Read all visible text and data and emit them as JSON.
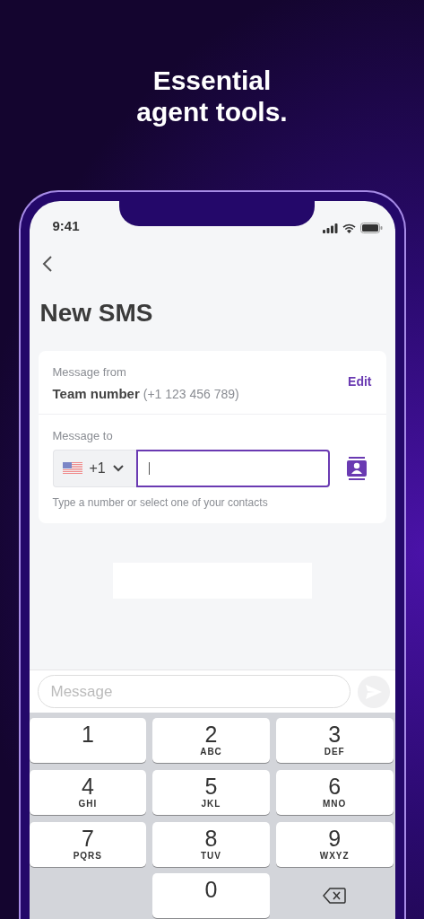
{
  "headline": [
    "Essential",
    "agent tools."
  ],
  "status_bar": {
    "time": "9:41"
  },
  "title": "New SMS",
  "message_from": {
    "label": "Message from",
    "name": "Team number",
    "number": "(+1 123 456 789)",
    "action": "Edit"
  },
  "message_to": {
    "label": "Message to",
    "country_code": "+1",
    "focused": true,
    "hint": "Type a number or select one of your contacts"
  },
  "composer": {
    "placeholder": "Message",
    "send_disabled": true
  },
  "keypad": [
    {
      "kind": "digit",
      "digit": "1"
    },
    {
      "kind": "digit",
      "digit": "2",
      "letters": "ABC"
    },
    {
      "kind": "digit",
      "digit": "3",
      "letters": "DEF"
    },
    {
      "kind": "digit",
      "digit": "4",
      "letters": "GHI"
    },
    {
      "kind": "digit",
      "digit": "5",
      "letters": "JKL"
    },
    {
      "kind": "digit",
      "digit": "6",
      "letters": "MNO"
    },
    {
      "kind": "digit",
      "digit": "7",
      "letters": "PQRS"
    },
    {
      "kind": "digit",
      "digit": "8",
      "letters": "TUV"
    },
    {
      "kind": "digit",
      "digit": "9",
      "letters": "WXYZ"
    },
    {
      "kind": "blank"
    },
    {
      "kind": "digit",
      "digit": "0"
    },
    {
      "kind": "delete"
    }
  ]
}
